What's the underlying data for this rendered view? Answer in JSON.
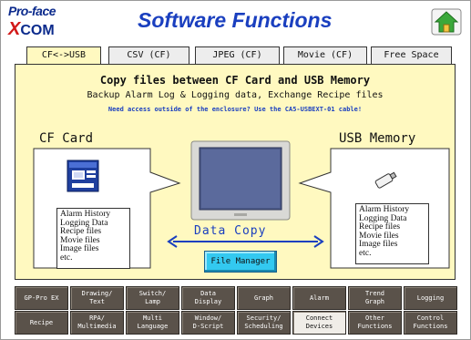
{
  "header": {
    "logo_top": "Pro-face",
    "logo_x": "X",
    "logo_bottom": "COM",
    "title": "Software Functions"
  },
  "tabs": [
    {
      "label": "CF<->USB",
      "active": true
    },
    {
      "label": "CSV (CF)",
      "active": false
    },
    {
      "label": "JPEG (CF)",
      "active": false
    },
    {
      "label": "Movie (CF)",
      "active": false
    },
    {
      "label": "Free Space",
      "active": false
    }
  ],
  "panel": {
    "heading": "Copy files between CF Card and USB Memory",
    "subheading": "Backup Alarm Log & Logging data, Exchange Recipe files",
    "note": "Need access outside of the enclosure? Use the CA5-USBEXT-01 cable!",
    "cf_label": "CF Card",
    "usb_label": "USB Memory",
    "cf_list": [
      "Alarm History",
      "Logging Data",
      "Recipe files",
      "Movie files",
      "Image files",
      "etc."
    ],
    "usb_list": [
      "Alarm History",
      "Logging Data",
      "Recipe files",
      "Movie files",
      "Image files",
      "etc."
    ],
    "copy_label": "Data Copy",
    "file_manager_label": "File Manager"
  },
  "nav_row1": [
    "GP-Pro EX",
    "Drawing/\nText",
    "Switch/\nLamp",
    "Data\nDisplay",
    "Graph",
    "Alarm",
    "Trend\nGraph",
    "Logging"
  ],
  "nav_row2": [
    "Recipe",
    "RPA/\nMultimedia",
    "Multi\nLanguage",
    "Window/\nD-Script",
    "Security/\nScheduling",
    "Connect\nDevices",
    "Other\nFunctions",
    "Control\nFunctions"
  ],
  "nav_active_row2_index": 5,
  "colors": {
    "title_blue": "#1a3fbf",
    "panel_yellow": "#fff9c0",
    "button_cyan": "#33c9f0",
    "nav_brown": "#5a524a"
  }
}
